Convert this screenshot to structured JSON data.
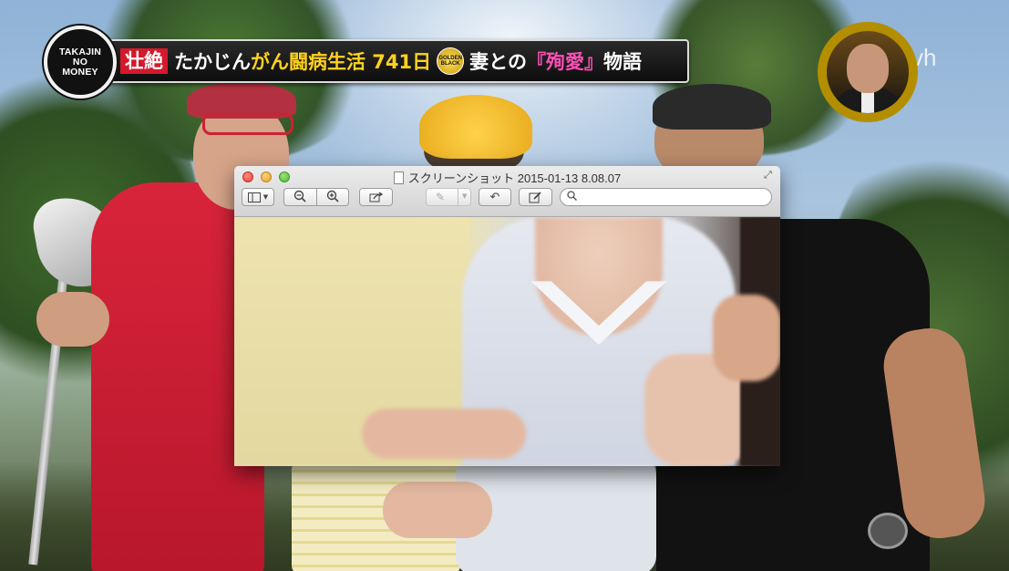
{
  "broadcast": {
    "logo_lines": [
      "TAKAJIN",
      "NO",
      "MONEY"
    ],
    "headline": {
      "red_box": "壮絶",
      "part1": "たかじん",
      "part2": "がん闘病生活 741日",
      "badge_lines": [
        "GOLDEN",
        "BLACK"
      ],
      "part3": "妻との",
      "part4": "『殉愛』",
      "part5": "物語"
    },
    "channel_logo": "vh"
  },
  "preview_window": {
    "title": "スクリーンショット 2015-01-13 8.08.07",
    "toolbar": {
      "sidebar_button_icon": "sidebar-icon",
      "zoom_out_icon": "zoom-out-icon",
      "zoom_in_icon": "zoom-in-icon",
      "share_icon": "share-icon",
      "annotate_icon": "pen-icon",
      "rotate_icon": "rotate-icon",
      "edit_icon": "edit-icon"
    },
    "search": {
      "placeholder": "",
      "value": ""
    }
  },
  "colors": {
    "ticker_red": "#d4192c",
    "ticker_yellow": "#ffd21e",
    "ticker_pink": "#ff4fb8",
    "portrait_gold": "#f7dc36"
  }
}
